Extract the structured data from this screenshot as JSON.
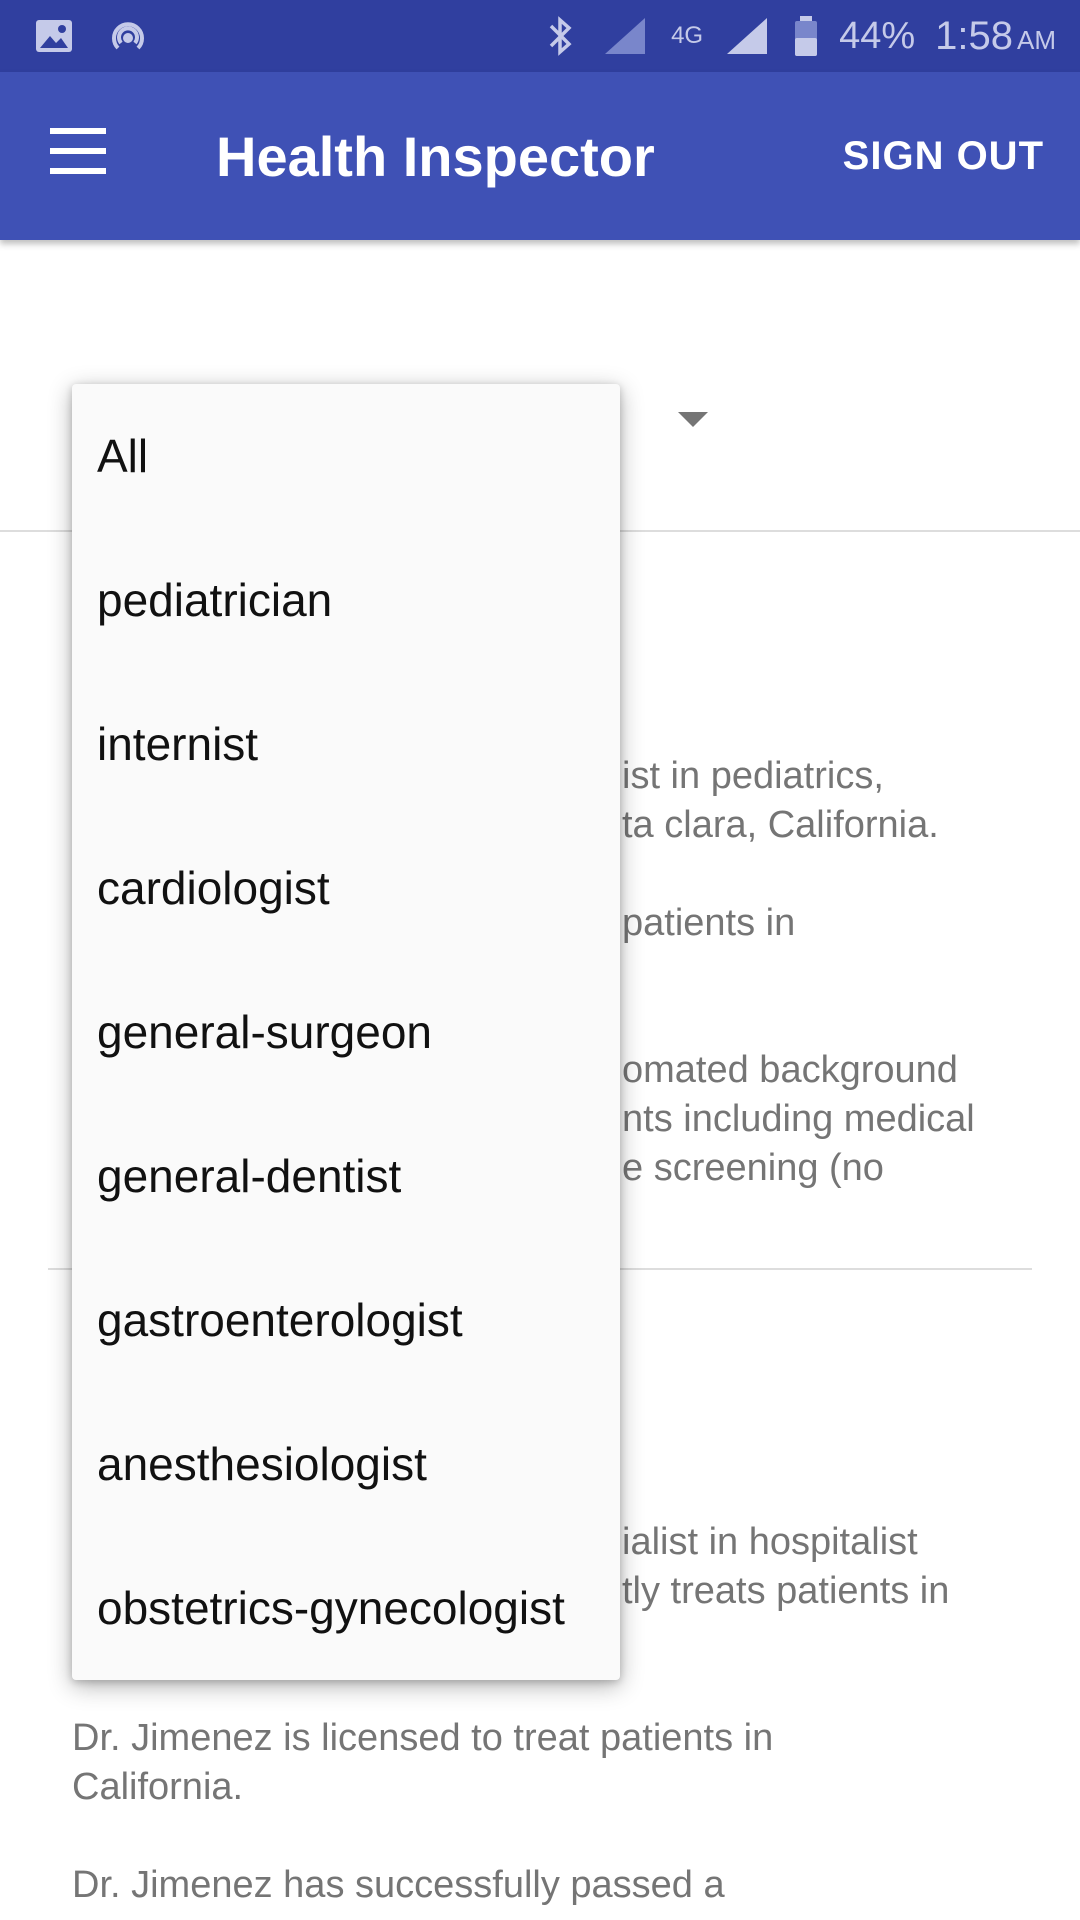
{
  "status_bar": {
    "battery": "44%",
    "time": "1:58",
    "ampm": "AM",
    "network": "4G",
    "icons": [
      "image-icon",
      "hotspot-icon",
      "bluetooth-icon",
      "signal-icon",
      "battery-icon"
    ]
  },
  "app_bar": {
    "title": "Health Inspector",
    "sign_out": "SIGN OUT",
    "menu_icon": "hamburger-icon",
    "color": "#3f51b5"
  },
  "background_cards": [
    {
      "lines": [
        "ist in pediatrics,",
        "ta clara, California.",
        "patients in",
        "omated background",
        "nts including medical",
        "e screening (no"
      ]
    },
    {
      "lines": [
        "ialist in hospitalist",
        "tly treats patients in",
        "Dr. Jimenez is licensed to treat patients in",
        "California.",
        "Dr. Jimenez has successfully passed a"
      ]
    }
  ],
  "dropdown": {
    "options": [
      "All",
      "pediatrician",
      "internist",
      "cardiologist",
      "general-surgeon",
      "general-dentist",
      "gastroenterologist",
      "anesthesiologist",
      "obstetrics-gynecologist"
    ]
  }
}
